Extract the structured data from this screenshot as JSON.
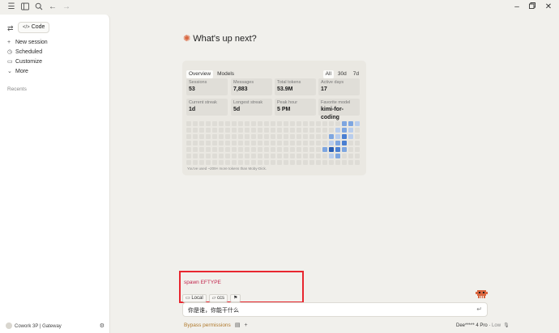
{
  "titlebar": {
    "icons": [
      "menu-icon",
      "sidebar-panel-icon",
      "search-icon",
      "back-arrow-icon",
      "forward-arrow-icon"
    ],
    "window_controls": [
      "minimize-icon",
      "restore-icon",
      "close-icon"
    ]
  },
  "sidebar": {
    "code_label": "Code",
    "items": [
      {
        "label": "New session",
        "icon": "plus-icon"
      },
      {
        "label": "Scheduled",
        "icon": "clock-icon"
      },
      {
        "label": "Customize",
        "icon": "briefcase-icon"
      },
      {
        "label": "More",
        "icon": "chevron-down-icon"
      }
    ],
    "recents_label": "Recents",
    "footer_text": "Cowork 3P | Gateway"
  },
  "main": {
    "headline": "What's up next?",
    "stats": {
      "tabs": [
        "Overview",
        "Models"
      ],
      "active_tab": "Overview",
      "ranges": [
        "All",
        "30d",
        "7d"
      ],
      "active_range": "All",
      "cells": [
        {
          "label": "Sessions",
          "value": "53"
        },
        {
          "label": "Messages",
          "value": "7,883"
        },
        {
          "label": "Total tokens",
          "value": "53.9M"
        },
        {
          "label": "Active days",
          "value": "17"
        },
        {
          "label": "Current streak",
          "value": "1d"
        },
        {
          "label": "Longest streak",
          "value": "5d"
        },
        {
          "label": "Peak hour",
          "value": "5 PM"
        },
        {
          "label": "Favorite model",
          "value": "kimi-for-coding"
        }
      ],
      "note": "You've used ~209× more tokens than Moby-Dick.",
      "heatmap_colors": {
        "empty": "#dedcd6",
        "l1": "#b9cdec",
        "l2": "#7ea6e0",
        "l3": "#4a7fd1",
        "l4": "#2a5fb5"
      }
    },
    "spawn_error": "spawn EFTYPE",
    "chips": [
      {
        "label": "Local",
        "icon": "laptop-icon"
      },
      {
        "label": "ccs",
        "icon": "folder-icon"
      },
      {
        "label": "",
        "icon": "flag-icon"
      }
    ],
    "input_text": "你是谁，你能干什么",
    "bottom": {
      "bypass": "Bypass permissions",
      "model_name": "Dee***** 4 Pro",
      "effort": "Low"
    }
  }
}
